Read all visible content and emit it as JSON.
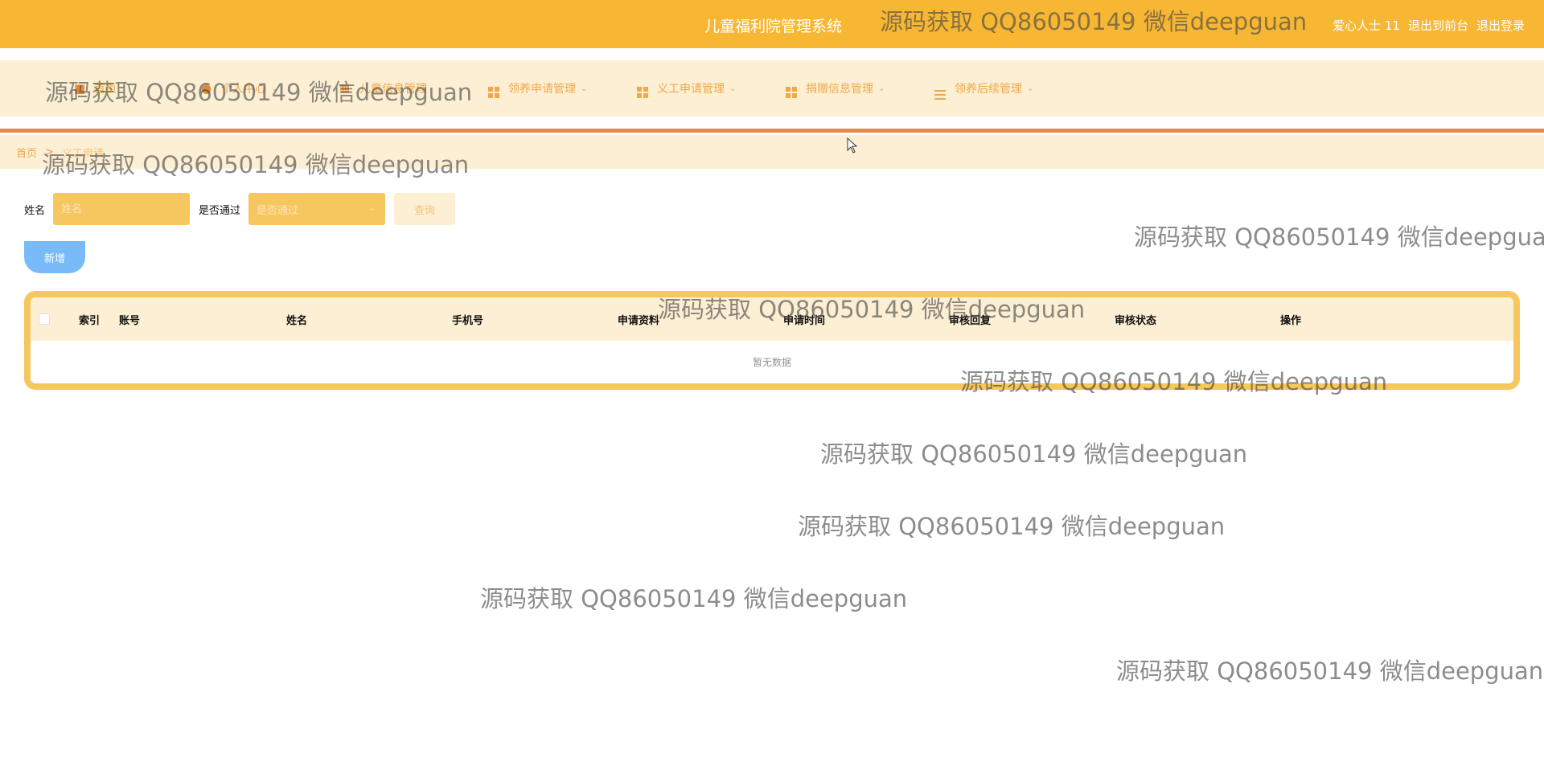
{
  "header": {
    "system_title": "儿童福利院管理系统",
    "user_name": "爱心人士 11",
    "back_to_front": "退出到前台",
    "logout": "退出登录"
  },
  "nav": {
    "items": [
      {
        "label": "首页",
        "icon": "home-icon"
      },
      {
        "label": "个人中心",
        "icon": "person-icon"
      },
      {
        "label": "儿童信息管理",
        "icon": "document-icon"
      },
      {
        "label": "领养申请管理",
        "icon": "grid-icon"
      },
      {
        "label": "义工申请管理",
        "icon": "grid-icon"
      },
      {
        "label": "捐赠信息管理",
        "icon": "grid-icon"
      },
      {
        "label": "领养后续管理",
        "icon": "list-icon"
      }
    ]
  },
  "breadcrumb": {
    "home": "首页",
    "separator": ">",
    "current": "义工申请"
  },
  "search": {
    "name_label": "姓名",
    "name_placeholder": "姓名",
    "passed_label": "是否通过",
    "passed_placeholder": "是否通过",
    "query_button": "查询"
  },
  "actions": {
    "add_button": "新增"
  },
  "table": {
    "columns": [
      "索引",
      "账号",
      "姓名",
      "手机号",
      "申请资料",
      "申请时间",
      "审核回复",
      "审核状态",
      "操作"
    ],
    "empty_text": "暂无数据"
  },
  "watermark": {
    "text": "源码获取 QQ86050149 微信deepguan"
  },
  "colors": {
    "primary": "#f7b733",
    "nav_bg": "#fdefd3",
    "accent_line": "#e8884a",
    "input_bg": "#f7c75f",
    "add_button": "#79bbf9"
  }
}
